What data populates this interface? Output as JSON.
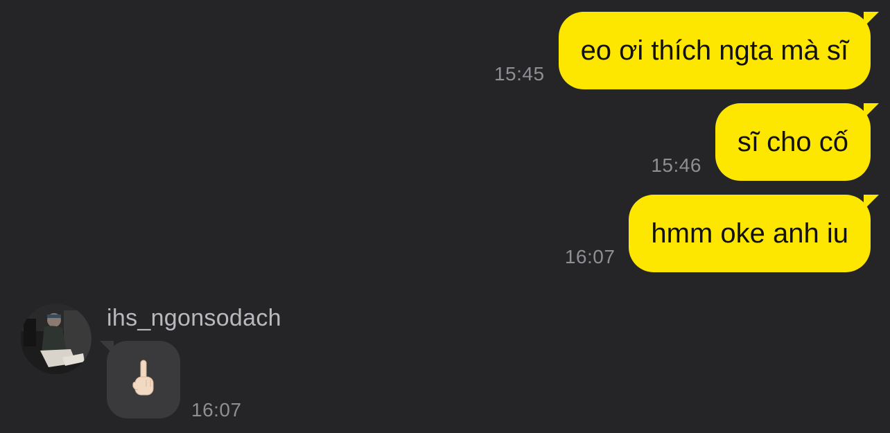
{
  "messages_out": [
    {
      "text": "eo ơi thích ngta mà sĩ",
      "time": "15:45"
    },
    {
      "text": "sĩ cho cố",
      "time": "15:46"
    },
    {
      "text": "hmm oke anh iu",
      "time": "16:07"
    }
  ],
  "message_in": {
    "sender": "ihs_ngonsodach",
    "time": "16:07",
    "content_icon": "middle-finger-emoji"
  },
  "colors": {
    "background": "#252528",
    "outgoing_bubble": "#fde600",
    "incoming_bubble": "#3a3a3d",
    "timestamp": "#8e8e93"
  }
}
